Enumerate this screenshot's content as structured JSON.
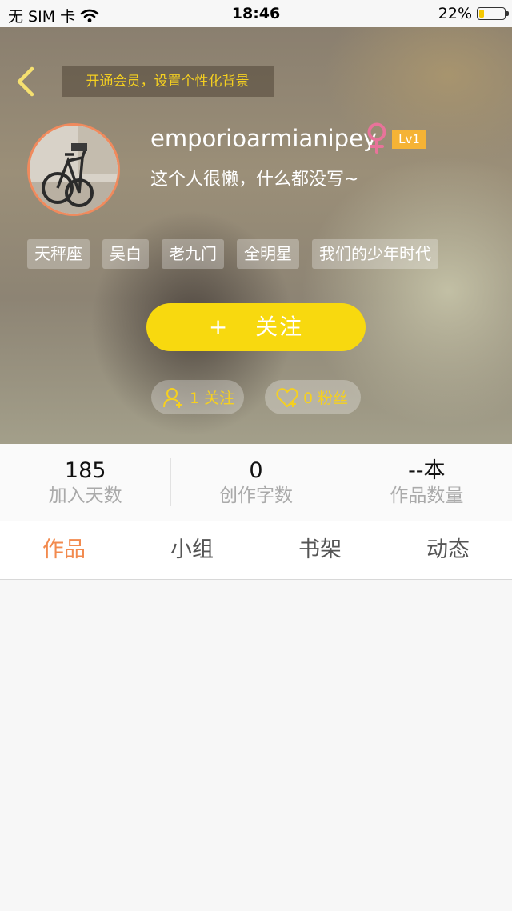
{
  "status_bar": {
    "carrier": "无 SIM 卡",
    "time": "18:46",
    "battery": "22%",
    "battery_level": 0.22
  },
  "header": {
    "vip_banner": "开通会员，设置个性化背景"
  },
  "profile": {
    "username": "emporioarmianipey",
    "level": "Lv1",
    "bio": "这个人很懒，什么都没写~",
    "gender_icon": "female-icon"
  },
  "tags": [
    "天秤座",
    "吴白",
    "老九门",
    "全明星",
    "我们的少年时代"
  ],
  "follow_button": {
    "icon": "+",
    "label": "关注"
  },
  "social": {
    "following": "1 关注",
    "fans": "0 粉丝"
  },
  "stats": [
    {
      "value": "185",
      "label": "加入天数"
    },
    {
      "value": "0",
      "label": "创作字数"
    },
    {
      "value": "--本",
      "label": "作品数量"
    }
  ],
  "tabs": [
    {
      "label": "作品",
      "active": true
    },
    {
      "label": "小组",
      "active": false
    },
    {
      "label": "书架",
      "active": false
    },
    {
      "label": "动态",
      "active": false
    }
  ],
  "colors": {
    "accent_yellow": "#f8d90f",
    "active_tab": "#f28a4e",
    "level_badge": "#f5b335",
    "female_icon": "#e8739a"
  }
}
